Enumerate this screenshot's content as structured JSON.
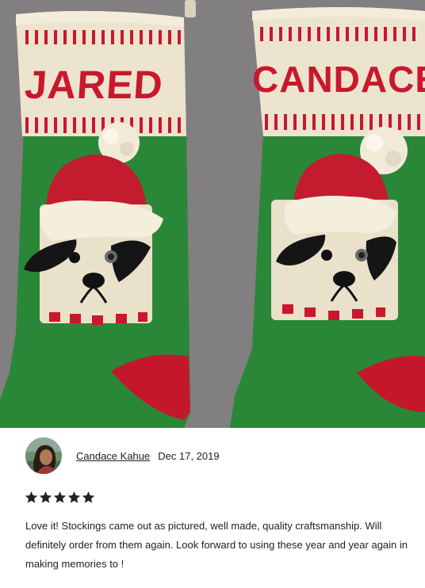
{
  "review": {
    "photo_icon": "stocking-photo",
    "avatar_icon": "reviewer-avatar",
    "reviewer_name": "Candace Kahue",
    "date": "Dec 17, 2019",
    "rating": 5,
    "rating_max": 5,
    "star_color": "#222222",
    "text": "Love it! Stockings came out as pictured, well made, quality craftsmanship. Will definitely order from them again. Look forward to using these year and year again in making memories to !",
    "stocking_names": [
      "JARED",
      "CANDACE"
    ]
  }
}
